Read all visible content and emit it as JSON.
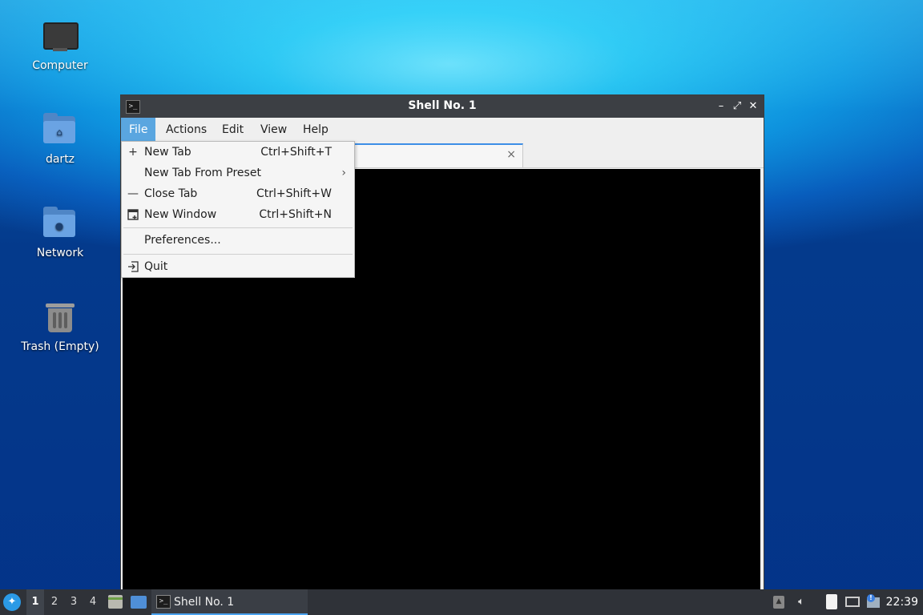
{
  "desktop": {
    "icons": [
      {
        "label": "Computer",
        "icon": "computer-icon"
      },
      {
        "label": "dartz",
        "icon": "home-folder-icon"
      },
      {
        "label": "Network",
        "icon": "network-folder-icon"
      },
      {
        "label": "Trash (Empty)",
        "icon": "trash-icon"
      }
    ]
  },
  "window": {
    "title": "Shell No. 1",
    "app_icon": "terminal-icon",
    "buttons": {
      "minimize": "–",
      "maximize": "⤢",
      "close": "✕"
    },
    "menubar": [
      {
        "label": "File",
        "active": true
      },
      {
        "label": "Actions"
      },
      {
        "label": "Edit"
      },
      {
        "label": "View"
      },
      {
        "label": "Help"
      }
    ],
    "tab": {
      "close": "×"
    }
  },
  "file_menu": {
    "items": [
      {
        "label": "New Tab",
        "shortcut": "Ctrl+Shift+T",
        "icon": "plus-icon"
      },
      {
        "label": "New Tab From Preset",
        "shortcut": "",
        "submenu": "›"
      },
      {
        "label": "Close Tab",
        "shortcut": "Ctrl+Shift+W",
        "icon": "minus-icon"
      },
      {
        "label": "New Window",
        "shortcut": "Ctrl+Shift+N",
        "icon": "new-window-icon"
      },
      {
        "label": "Preferences...",
        "shortcut": ""
      },
      {
        "label": "Quit",
        "shortcut": "",
        "icon": "quit-icon"
      }
    ]
  },
  "taskbar": {
    "workspaces": [
      "1",
      "2",
      "3",
      "4"
    ],
    "active_workspace": "1",
    "task_label": "Shell No. 1",
    "clock": "22:39"
  },
  "colors": {
    "accent": "#5aa6e0",
    "titlebar": "#3c3f44",
    "taskbar": "#2f3238"
  }
}
